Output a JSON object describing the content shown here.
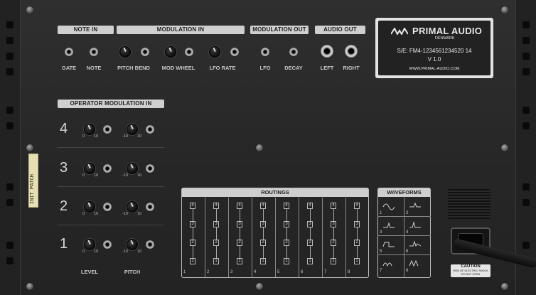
{
  "sections": {
    "note_in": "NOTE IN",
    "modulation_in": "MODULATION IN",
    "modulation_out": "MODULATION OUT",
    "audio_out": "AUDIO OUT",
    "operator_modulation_in": "OPERATOR MODULATION IN",
    "routings": "ROUTINGS",
    "waveforms": "WAVEFORMS"
  },
  "jack_labels": {
    "gate": "GATE",
    "note": "NOTE",
    "pitch_bend": "PITCH BEND",
    "mod_wheel": "MOD WHEEL",
    "lfo_rate": "LFO RATE",
    "lfo": "LFO",
    "decay": "DECAY",
    "left": "LEFT",
    "right": "RIGHT"
  },
  "knob_scale": {
    "min": "0",
    "max": "10",
    "bip_min": "-10",
    "bip_max": "10"
  },
  "operators": [
    "4",
    "3",
    "2",
    "1"
  ],
  "column_labels": {
    "level": "LEVEL",
    "pitch": "PITCH"
  },
  "plate": {
    "brand": "PRIMAL AUDIO",
    "country": "DENMARK",
    "serial": "S/E:  FM4-1234561234520 14",
    "version": "V 1.0",
    "url": "WWW.PRIMAL-AUDIO.COM"
  },
  "routings": [
    "1",
    "2",
    "3",
    "4",
    "5",
    "6",
    "7",
    "8"
  ],
  "waveforms": [
    "1",
    "2",
    "3",
    "4",
    "5",
    "6",
    "7",
    "8"
  ],
  "sticker": "INIT PATCH",
  "caution": {
    "title": "CAUTION",
    "line1": "RISK OF ELECTRIC SHOCK",
    "line2": "DO NOT OPEN"
  },
  "colors": {
    "panel": "#2a2a2a",
    "header": "#cfcfcf",
    "sticker": "#e7dfb4"
  }
}
